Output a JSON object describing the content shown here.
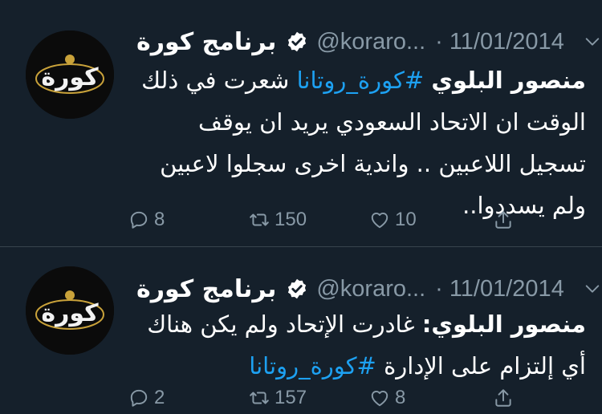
{
  "colors": {
    "background": "#15202b",
    "text": "#ffffff",
    "secondary": "#8899a6",
    "link": "#1da1f2",
    "divider": "#38444d"
  },
  "icons": {
    "verified": "verified-badge-icon",
    "more": "chevron-down-icon",
    "reply": "reply-icon",
    "retweet": "retweet-icon",
    "like": "heart-icon",
    "share": "share-icon"
  },
  "tweets": [
    {
      "avatar_text": "كورة",
      "name": "برنامج كورة",
      "handle": "@koraro...",
      "separator": "·",
      "date": "11/01/2014",
      "body": {
        "mention": "منصور البلوي",
        "hashtag": "#كورة_روتانا",
        "text": "شعرت في ذلك الوقت ان الاتحاد السعودي يريد ان يوقف تسجيل اللاعبين .. واندية اخرى سجلوا لاعبين ولم يسددوا.."
      },
      "replies": "8",
      "retweets": "150",
      "likes": "10"
    },
    {
      "avatar_text": "كورة",
      "name": "برنامج كورة",
      "handle": "@koraro...",
      "separator": "·",
      "date": "11/01/2014",
      "body": {
        "mention": "منصور البلوي:",
        "text": "غادرت الإتحاد ولم يكن هناك أي إلتزام على الإدارة",
        "hashtag": "#كورة_روتانا"
      },
      "replies": "2",
      "retweets": "157",
      "likes": "8"
    }
  ]
}
